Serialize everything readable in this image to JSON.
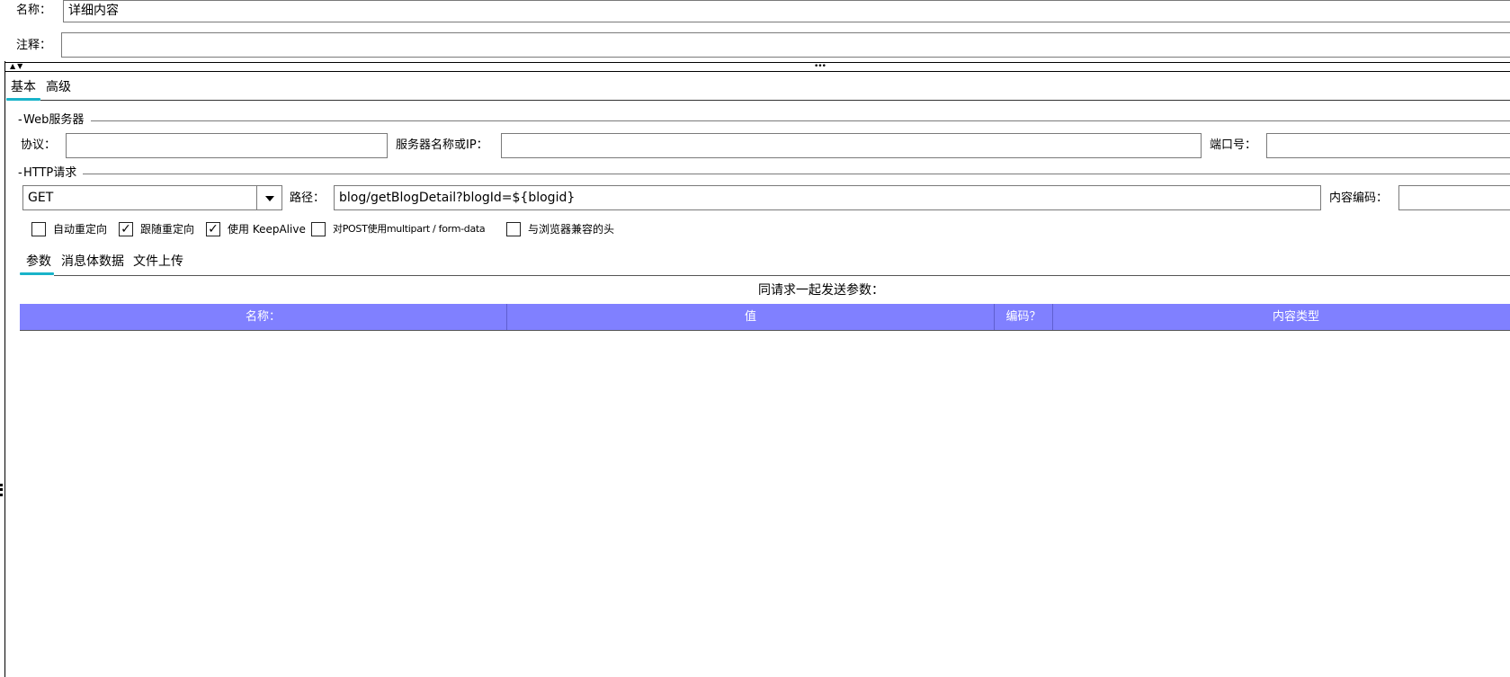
{
  "header": {
    "name_label": "名称：",
    "name_value": "详细内容",
    "comment_label": "注释：",
    "comment_value": ""
  },
  "splitter": {
    "arrows": "▲▼",
    "grip": "•••"
  },
  "main_tabs": [
    {
      "label": "基本",
      "active": true
    },
    {
      "label": "高级",
      "active": false
    }
  ],
  "web_server": {
    "legend": "Web服务器",
    "protocol_label": "协议：",
    "protocol_value": "",
    "server_label": "服务器名称或IP：",
    "server_value": "",
    "port_label": "端口号：",
    "port_value": ""
  },
  "http_request": {
    "legend": "HTTP请求",
    "method": "GET",
    "path_label": "路径：",
    "path_value": "blog/getBlogDetail?blogId=${blogid}",
    "encoding_label": "内容编码：",
    "encoding_value": ""
  },
  "options": [
    {
      "label": "自动重定向",
      "checked": false
    },
    {
      "label": "跟随重定向",
      "checked": true
    },
    {
      "label": "使用 KeepAlive",
      "checked": true
    },
    {
      "label": "对POST使用multipart / form-data",
      "checked": false
    },
    {
      "label": "与浏览器兼容的头",
      "checked": false
    }
  ],
  "sub_tabs": [
    {
      "label": "参数",
      "active": true
    },
    {
      "label": "消息体数据",
      "active": false
    },
    {
      "label": "文件上传",
      "active": false
    }
  ],
  "params": {
    "caption": "同请求一起发送参数：",
    "columns": [
      "名称：",
      "值",
      "编码？",
      "内容类型"
    ],
    "rows": []
  },
  "colors": {
    "table_header": "#8080ff",
    "tab_underline": "#19b3c9"
  },
  "icons": {
    "dropdown": "chevron-down-icon",
    "check": "check-icon"
  }
}
